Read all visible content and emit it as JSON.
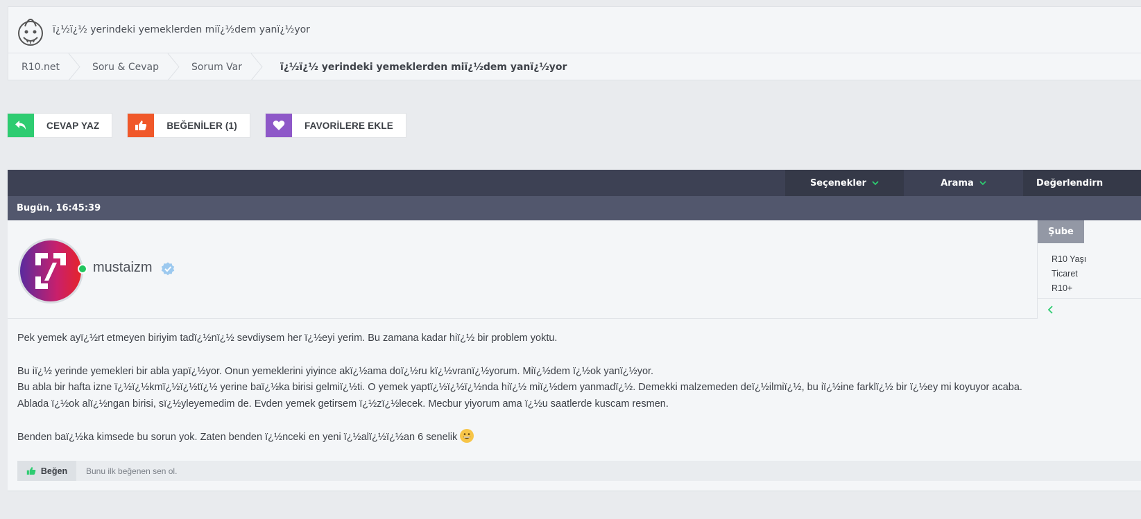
{
  "page": {
    "title": "ï¿½ï¿½ yerindeki yemeklerden miï¿½dem yanï¿½yor"
  },
  "breadcrumb": [
    "R10.net",
    "Soru & Cevap",
    "Sorum Var",
    "ï¿½ï¿½ yerindeki yemeklerden miï¿½dem yanï¿½yor"
  ],
  "actions": {
    "reply": "CEVAP YAZ",
    "likes": "BEĞENİLER (1)",
    "favorite": "FAVORİLERE EKLE"
  },
  "thread_nav": {
    "options": "Seçenekler",
    "search": "Arama",
    "rating": "Değerlendirn"
  },
  "post": {
    "date": "Bugün, 16:45:39",
    "username": "mustaizm",
    "side": {
      "tab": "Şube",
      "items": [
        "R10 Yaşı",
        "Ticaret",
        "R10+"
      ]
    },
    "paragraphs": [
      "Pek yemek ayï¿½rt etmeyen biriyim tadï¿½nï¿½ sevdiysem her ï¿½eyi yerim. Bu zamana kadar hiï¿½ bir problem yoktu.",
      "Bu iï¿½ yerinde yemekleri bir abla yapï¿½yor. Onun yemeklerini yiyince akï¿½ama doï¿½ru kï¿½vranï¿½yorum. Miï¿½dem ï¿½ok yanï¿½yor.",
      "Bu abla bir hafta izne ï¿½ï¿½kmï¿½ï¿½tï¿½ yerine baï¿½ka birisi gelmiï¿½ti. O yemek yaptï¿½ï¿½ï¿½nda hiï¿½ miï¿½dem yanmadï¿½. Demekki malzemeden deï¿½ilmiï¿½, bu iï¿½ine farklï¿½ bir ï¿½ey mi koyuyor acaba.",
      "Ablada ï¿½ok alï¿½ngan birisi, sï¿½yleyemedim de. Evden yemek getirsem ï¿½zï¿½lecek. Mecbur yiyorum ama ï¿½u saatlerde kuscam resmen.",
      "Benden baï¿½ka kimsede bu sorun yok. Zaten benden ï¿½nceki en yeni ï¿½alï¿½ï¿½an 6 senelik"
    ],
    "emoji": "grinning-face-emoji",
    "like_button": "Beğen",
    "like_text": "Bunu ilk beğenen sen ol."
  },
  "colors": {
    "reply_accent": "#2ecc71",
    "likes_accent": "#f0582a",
    "favorite_accent": "#8e58c8",
    "thread_bar": "#3d4154",
    "date_bar": "#52576d",
    "online": "#22c55e"
  }
}
